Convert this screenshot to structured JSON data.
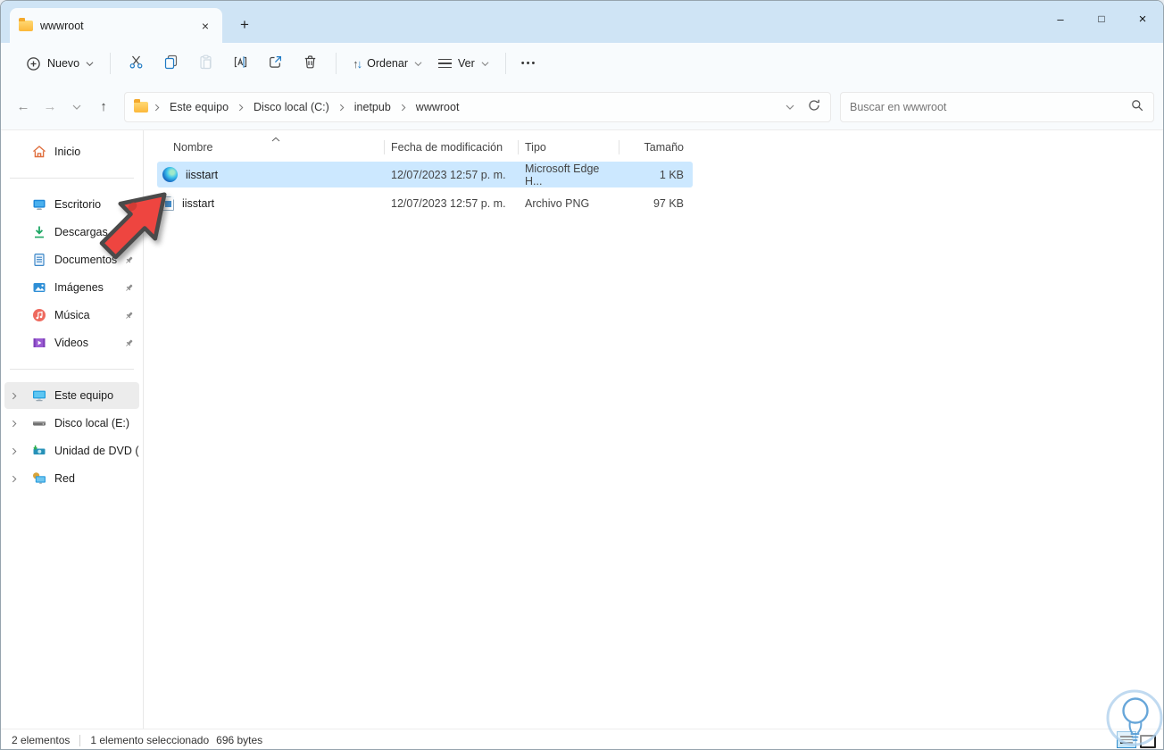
{
  "window": {
    "tab_title": "wwwroot",
    "tab_close_glyph": "×",
    "new_tab_glyph": "+",
    "minimize_glyph": "–",
    "maximize_glyph": "□",
    "close_glyph": "×"
  },
  "toolbar": {
    "new_label": "Nuevo",
    "sort_label": "Ordenar",
    "sort_up_glyph": "↑",
    "sort_down_glyph": "↓",
    "view_label": "Ver",
    "more_glyph": "•••"
  },
  "navigation": {
    "back_glyph": "←",
    "forward_glyph": "→",
    "up_glyph": "↑"
  },
  "address": {
    "breadcrumbs": [
      "Este equipo",
      "Disco local (C:)",
      "inetpub",
      "wwwroot"
    ]
  },
  "search": {
    "placeholder": "Buscar en wwwroot"
  },
  "sidebar": {
    "home_label": "Inicio",
    "quick_items": [
      {
        "label": "Escritorio",
        "icon": "desktop-icon",
        "pinned": true
      },
      {
        "label": "Descargas",
        "icon": "downloads-icon",
        "pinned": true
      },
      {
        "label": "Documentos",
        "icon": "documents-icon",
        "pinned": true
      },
      {
        "label": "Imágenes",
        "icon": "pictures-icon",
        "pinned": true
      },
      {
        "label": "Música",
        "icon": "music-icon",
        "pinned": true
      },
      {
        "label": "Videos",
        "icon": "videos-icon",
        "pinned": true
      }
    ],
    "tree_items": [
      {
        "label": "Este equipo",
        "icon": "this-pc-icon",
        "selected": true
      },
      {
        "label": "Disco local (E:)",
        "icon": "local-disk-icon",
        "selected": false
      },
      {
        "label": "Unidad de DVD (D:)",
        "icon": "dvd-drive-icon",
        "selected": false
      },
      {
        "label": "Red",
        "icon": "network-icon",
        "selected": false
      }
    ]
  },
  "file_list": {
    "columns": [
      "Nombre",
      "Fecha de modificación",
      "Tipo",
      "Tamaño"
    ],
    "sort_column": "Nombre",
    "sort_direction": "asc",
    "rows": [
      {
        "name": "iisstart",
        "modified": "12/07/2023 12:57 p. m.",
        "type": "Microsoft Edge H...",
        "size": "1 KB",
        "icon": "edge-html-icon",
        "selected": true
      },
      {
        "name": "iisstart",
        "modified": "12/07/2023 12:57 p. m.",
        "type": "Archivo PNG",
        "size": "97 KB",
        "icon": "png-image-icon",
        "selected": false
      }
    ]
  },
  "status_bar": {
    "items_count": "2 elementos",
    "selection_label": "1 elemento seleccionado",
    "selection_size": "696 bytes"
  },
  "colors": {
    "accent": "#0078d4",
    "titlebar": "#cfe4f5",
    "row_selection": "#cce8ff",
    "annotation_arrow": "#ee4540"
  }
}
